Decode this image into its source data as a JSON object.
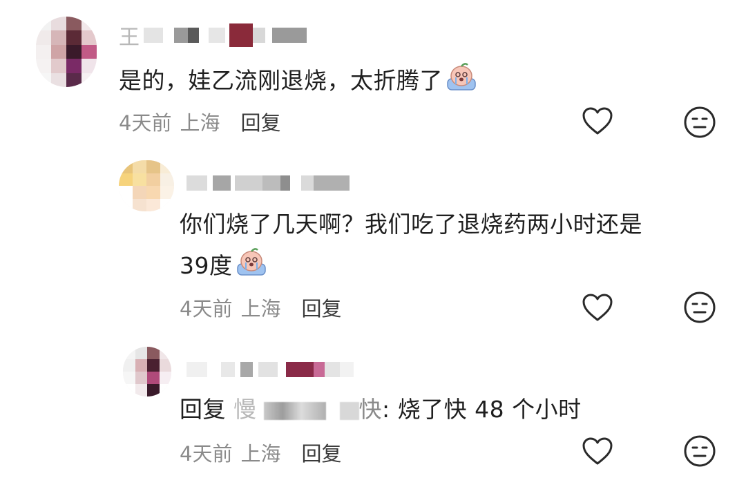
{
  "comments": [
    {
      "username_visible": "王",
      "text": "是的，娃乙流刚退烧，太折腾了",
      "time": "4天前",
      "location": "上海",
      "reply_label": "回复"
    },
    {
      "text": "你们烧了几天啊？我们吃了退烧药两小时还是",
      "text_line2": "39度",
      "time": "4天前",
      "location": "上海",
      "reply_label": "回复"
    },
    {
      "reply_prefix": "回复",
      "mention_start": "慢",
      "mention_end": "快",
      "text": ": 烧了快 48 个小时",
      "time": "4天前",
      "location": "上海",
      "reply_label": "回复"
    }
  ],
  "icons": {
    "like": "heart-outline-icon",
    "dislike": "meh-face-icon",
    "emoji": "crying-face-emoji"
  },
  "colors": {
    "text": "#1f1f1f",
    "meta": "#8a8a8a",
    "icon": "#2a2a2a"
  }
}
